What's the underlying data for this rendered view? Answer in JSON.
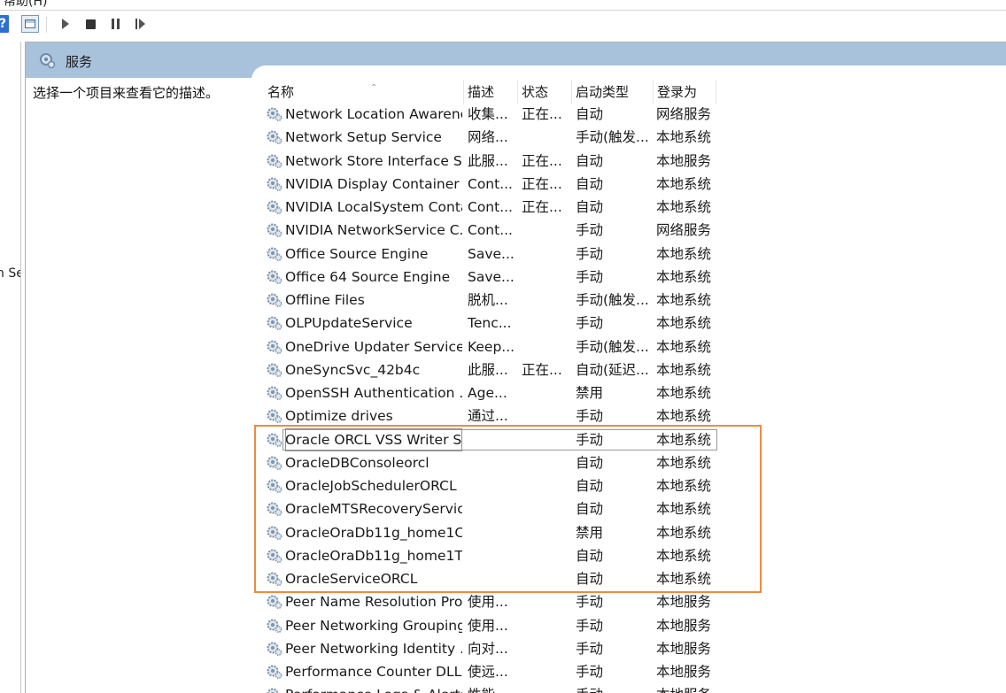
{
  "menubar": {
    "help_label": "帮助(H)"
  },
  "toolbar": {
    "help_icon": "help-icon",
    "console_icon": "console-tree-icon",
    "play_icon": "start-service-icon",
    "stop_icon": "stop-service-icon",
    "pause_icon": "pause-service-icon",
    "restart_icon": "restart-service-icon"
  },
  "left_panel": {
    "cut_text": "n Se"
  },
  "pane": {
    "title": "服务",
    "description_prompt": "选择一个项目来查看它的描述。"
  },
  "columns": {
    "name": "名称",
    "description": "描述",
    "status": "状态",
    "startup_type": "启动类型",
    "logon_as": "登录为"
  },
  "services": [
    {
      "name": "Network Location Awarene...",
      "description": "收集...",
      "status": "正在...",
      "startup": "自动",
      "logon": "网络服务"
    },
    {
      "name": "Network Setup Service",
      "description": "网络...",
      "status": "",
      "startup": "手动(触发...",
      "logon": "本地系统"
    },
    {
      "name": "Network Store Interface Se...",
      "description": "此服...",
      "status": "正在...",
      "startup": "自动",
      "logon": "本地服务"
    },
    {
      "name": "NVIDIA Display Container LS",
      "description": "Cont...",
      "status": "正在...",
      "startup": "自动",
      "logon": "本地系统"
    },
    {
      "name": "NVIDIA LocalSystem Conta...",
      "description": "Cont...",
      "status": "正在...",
      "startup": "自动",
      "logon": "本地系统"
    },
    {
      "name": "NVIDIA NetworkService C...",
      "description": "Cont...",
      "status": "",
      "startup": "手动",
      "logon": "网络服务"
    },
    {
      "name": "Office  Source Engine",
      "description": "Save...",
      "status": "",
      "startup": "手动",
      "logon": "本地系统"
    },
    {
      "name": "Office 64 Source Engine",
      "description": "Save...",
      "status": "",
      "startup": "手动",
      "logon": "本地系统"
    },
    {
      "name": "Offline Files",
      "description": "脱机...",
      "status": "",
      "startup": "手动(触发...",
      "logon": "本地系统"
    },
    {
      "name": "OLPUpdateService",
      "description": "Tenc...",
      "status": "",
      "startup": "手动",
      "logon": "本地系统"
    },
    {
      "name": "OneDrive Updater Service",
      "description": "Keep...",
      "status": "",
      "startup": "手动(触发...",
      "logon": "本地系统"
    },
    {
      "name": "OneSyncSvc_42b4c",
      "description": "此服...",
      "status": "正在...",
      "startup": "自动(延迟...",
      "logon": "本地系统"
    },
    {
      "name": "OpenSSH Authentication ...",
      "description": "Age...",
      "status": "",
      "startup": "禁用",
      "logon": "本地系统"
    },
    {
      "name": "Optimize drives",
      "description": "通过...",
      "status": "",
      "startup": "手动",
      "logon": "本地系统"
    },
    {
      "name": "Oracle ORCL VSS Writer S...",
      "description": "",
      "status": "",
      "startup": "手动",
      "logon": "本地系统",
      "selected": true
    },
    {
      "name": "OracleDBConsoleorcl",
      "description": "",
      "status": "",
      "startup": "自动",
      "logon": "本地系统"
    },
    {
      "name": "OracleJobSchedulerORCL",
      "description": "",
      "status": "",
      "startup": "自动",
      "logon": "本地系统"
    },
    {
      "name": "OracleMTSRecoveryService",
      "description": "",
      "status": "",
      "startup": "自动",
      "logon": "本地系统"
    },
    {
      "name": "OracleOraDb11g_home1C...",
      "description": "",
      "status": "",
      "startup": "禁用",
      "logon": "本地系统"
    },
    {
      "name": "OracleOraDb11g_home1T...",
      "description": "",
      "status": "",
      "startup": "自动",
      "logon": "本地系统"
    },
    {
      "name": "OracleServiceORCL",
      "description": "",
      "status": "",
      "startup": "自动",
      "logon": "本地系统"
    },
    {
      "name": "Peer Name Resolution Pro...",
      "description": "使用...",
      "status": "",
      "startup": "手动",
      "logon": "本地服务"
    },
    {
      "name": "Peer Networking Grouping",
      "description": "使用...",
      "status": "",
      "startup": "手动",
      "logon": "本地服务"
    },
    {
      "name": "Peer Networking Identity ...",
      "description": "向对...",
      "status": "",
      "startup": "手动",
      "logon": "本地服务"
    },
    {
      "name": "Performance Counter DLL ...",
      "description": "使远...",
      "status": "",
      "startup": "手动",
      "logon": "本地服务"
    },
    {
      "name": "Performance Logs & Alerts",
      "description": "性能...",
      "status": "",
      "startup": "手动",
      "logon": "本地服务"
    }
  ],
  "colors": {
    "header_bg": "#a9c2dc",
    "highlight_border": "#ee8b3e"
  }
}
